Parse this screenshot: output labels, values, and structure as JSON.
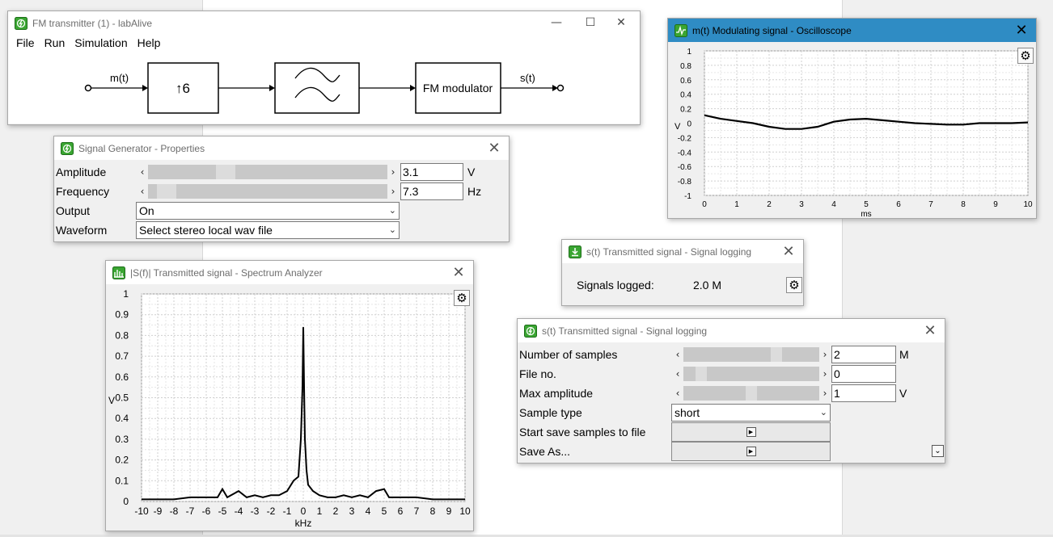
{
  "fm_window": {
    "title": "FM transmitter (1) - labAlive",
    "menu": [
      "File",
      "Run",
      "Simulation",
      "Help"
    ],
    "input_label": "m(t)",
    "upsample_label": "↑6",
    "modulator_label": "FM modulator",
    "output_label": "s(t)"
  },
  "signal_generator": {
    "title": "Signal Generator - Properties",
    "amplitude": {
      "label": "Amplitude",
      "value": "3.1",
      "unit": "V",
      "level": 0.31
    },
    "frequency": {
      "label": "Frequency",
      "value": "7.3",
      "unit": "Hz",
      "level": 0.04
    },
    "output": {
      "label": "Output",
      "selected": "On"
    },
    "waveform": {
      "label": "Waveform",
      "selected": "Select stereo local wav file"
    }
  },
  "oscilloscope": {
    "title": "m(t) Modulating signal - Oscilloscope",
    "ylabel": "V",
    "xlabel": "ms",
    "x_ticks": [
      "0",
      "1",
      "2",
      "3",
      "4",
      "5",
      "6",
      "7",
      "8",
      "9",
      "10"
    ],
    "y_ticks": [
      "1",
      "0.8",
      "0.6",
      "0.4",
      "0.2",
      "0",
      "-0.2",
      "-0.4",
      "-0.6",
      "-0.8",
      "-1"
    ],
    "settings_icon": "gear-icon"
  },
  "signal_logging_small": {
    "title": "s(t) Transmitted signal - Signal logging",
    "signals_logged_label": "Signals logged:",
    "signals_logged_value": "2.0 M"
  },
  "signal_logging_props": {
    "title": "s(t) Transmitted signal - Signal logging",
    "number_of_samples": {
      "label": "Number of samples",
      "value": "2",
      "unit": "M",
      "level": 0.7
    },
    "file_no": {
      "label": "File no.",
      "value": "0",
      "level": 0.1
    },
    "max_amplitude": {
      "label": "Max amplitude",
      "value": "1",
      "unit": "V",
      "level": 0.5
    },
    "sample_type": {
      "label": "Sample type",
      "selected": "short"
    },
    "start_save": {
      "label": "Start save samples to file"
    },
    "save_as": {
      "label": "Save As..."
    }
  },
  "spectrum": {
    "title": "|S(f)| Transmitted signal - Spectrum Analyzer",
    "ylabel": "V",
    "xlabel": "kHz",
    "x_ticks": [
      "-10",
      "-9",
      "-8",
      "-7",
      "-6",
      "-5",
      "-4",
      "-3",
      "-2",
      "-1",
      "0",
      "1",
      "2",
      "3",
      "4",
      "5",
      "6",
      "7",
      "8",
      "9",
      "10"
    ],
    "y_ticks": [
      "1",
      "0.9",
      "0.8",
      "0.7",
      "0.6",
      "0.5",
      "0.4",
      "0.3",
      "0.2",
      "0.1",
      "0"
    ]
  },
  "chart_data": [
    {
      "type": "line",
      "xlabel": "ms",
      "ylabel": "V",
      "xlim": [
        0,
        10
      ],
      "ylim": [
        -1,
        1
      ],
      "grid": true,
      "series": [
        {
          "x": [
            0,
            0.5,
            1,
            1.5,
            2,
            2.5,
            3,
            3.5,
            4,
            4.5,
            5,
            5.5,
            6,
            6.5,
            7,
            7.5,
            8,
            8.5,
            9,
            9.5,
            10
          ],
          "values": [
            0.11,
            0.06,
            0.03,
            0.0,
            -0.05,
            -0.08,
            -0.08,
            -0.05,
            0.02,
            0.05,
            0.06,
            0.04,
            0.02,
            0.0,
            -0.01,
            -0.02,
            -0.02,
            0.0,
            0.0,
            0.0,
            0.01
          ]
        }
      ]
    },
    {
      "type": "line",
      "xlabel": "kHz",
      "ylabel": "V",
      "xlim": [
        -10,
        10
      ],
      "ylim": [
        0,
        1
      ],
      "grid": true,
      "series": [
        {
          "x": [
            -10,
            -9,
            -8,
            -7,
            -6,
            -5.3,
            -5,
            -4.7,
            -4,
            -3.5,
            -3,
            -2.5,
            -2,
            -1.5,
            -1,
            -0.6,
            -0.3,
            -0.15,
            -0.05,
            0,
            0.05,
            0.1,
            0.2,
            0.3,
            0.6,
            1,
            1.5,
            2,
            2.5,
            3,
            3.5,
            4,
            4.5,
            5,
            5.3,
            6,
            7,
            8,
            9,
            10
          ],
          "values": [
            0.01,
            0.01,
            0.01,
            0.02,
            0.02,
            0.02,
            0.06,
            0.02,
            0.05,
            0.02,
            0.03,
            0.02,
            0.03,
            0.03,
            0.05,
            0.1,
            0.12,
            0.3,
            0.55,
            0.84,
            0.55,
            0.3,
            0.15,
            0.08,
            0.05,
            0.03,
            0.02,
            0.02,
            0.03,
            0.02,
            0.03,
            0.02,
            0.05,
            0.06,
            0.02,
            0.02,
            0.02,
            0.01,
            0.01,
            0.01
          ]
        }
      ]
    }
  ]
}
